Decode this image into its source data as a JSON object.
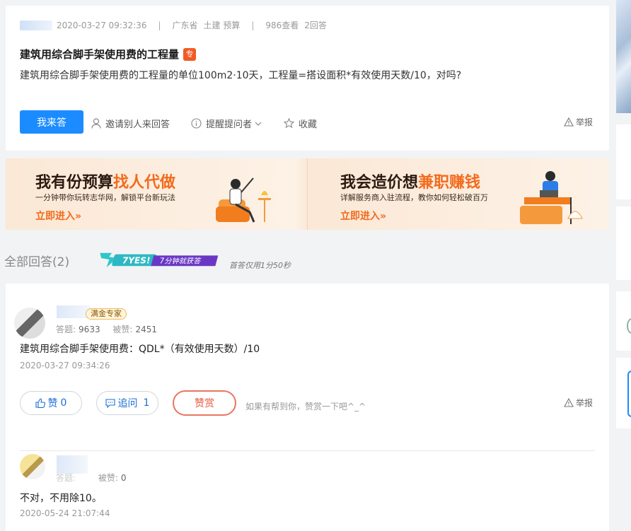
{
  "question": {
    "date": "2020-03-27 09:32:36",
    "sep1": "|",
    "region": "广东省",
    "category": "土建 预算",
    "sep2": "|",
    "views": "986查看",
    "answers": "2回答",
    "title": "建筑用综合脚手架使用费的工程量",
    "tag": "专",
    "body": "建筑用综合脚手架使用费的工程量的单位100m2·10天，工程量=搭设面积*有效使用天数/10，对吗?",
    "answer_button": "我来答",
    "invite": "邀请别人来回答",
    "remind": "提醒提问者",
    "favorite": "收藏",
    "report": "举报"
  },
  "banner": {
    "left_title_a": "我有份预算",
    "left_title_b": "找人代做",
    "left_sub": "一分钟带你玩转志华网，解锁平台新玩法",
    "left_link": "立即进入»",
    "right_title_a": "我会造价想",
    "right_title_b": "兼职赚钱",
    "right_sub": "详解服务商入驻流程，教你如何轻松破百万",
    "right_link": "立即进入»"
  },
  "answers_header": {
    "title": "全部回答(2)",
    "yes_text": "7YES!",
    "yes_sub": "7分钟就获答",
    "first_time": "首答仅用1分50秒"
  },
  "answers": [
    {
      "badge": "满金专家",
      "answers_label": "答题:",
      "answers_count": "9633",
      "likes_label": "被赞:",
      "likes_count": "2451",
      "text": "建筑用综合脚手架使用费：QDL*（有效使用天数）/10",
      "time": "2020-03-27 09:34:26",
      "like_label": "赞",
      "like_count": "0",
      "followup_label": "追问",
      "followup_count": "1",
      "reward_label": "赞赏",
      "hint": "如果有帮到你，赞赏一下吧^_^",
      "report": "举报"
    },
    {
      "answers_label": "答题:",
      "likes_label": "被赞:",
      "likes_count": "0",
      "text": "不对，不用除10。",
      "time": "2020-05-24 21:07:44"
    }
  ],
  "colors": {
    "primary": "#1a8cff",
    "accent": "#f26b1d",
    "reward": "#e8583c"
  }
}
